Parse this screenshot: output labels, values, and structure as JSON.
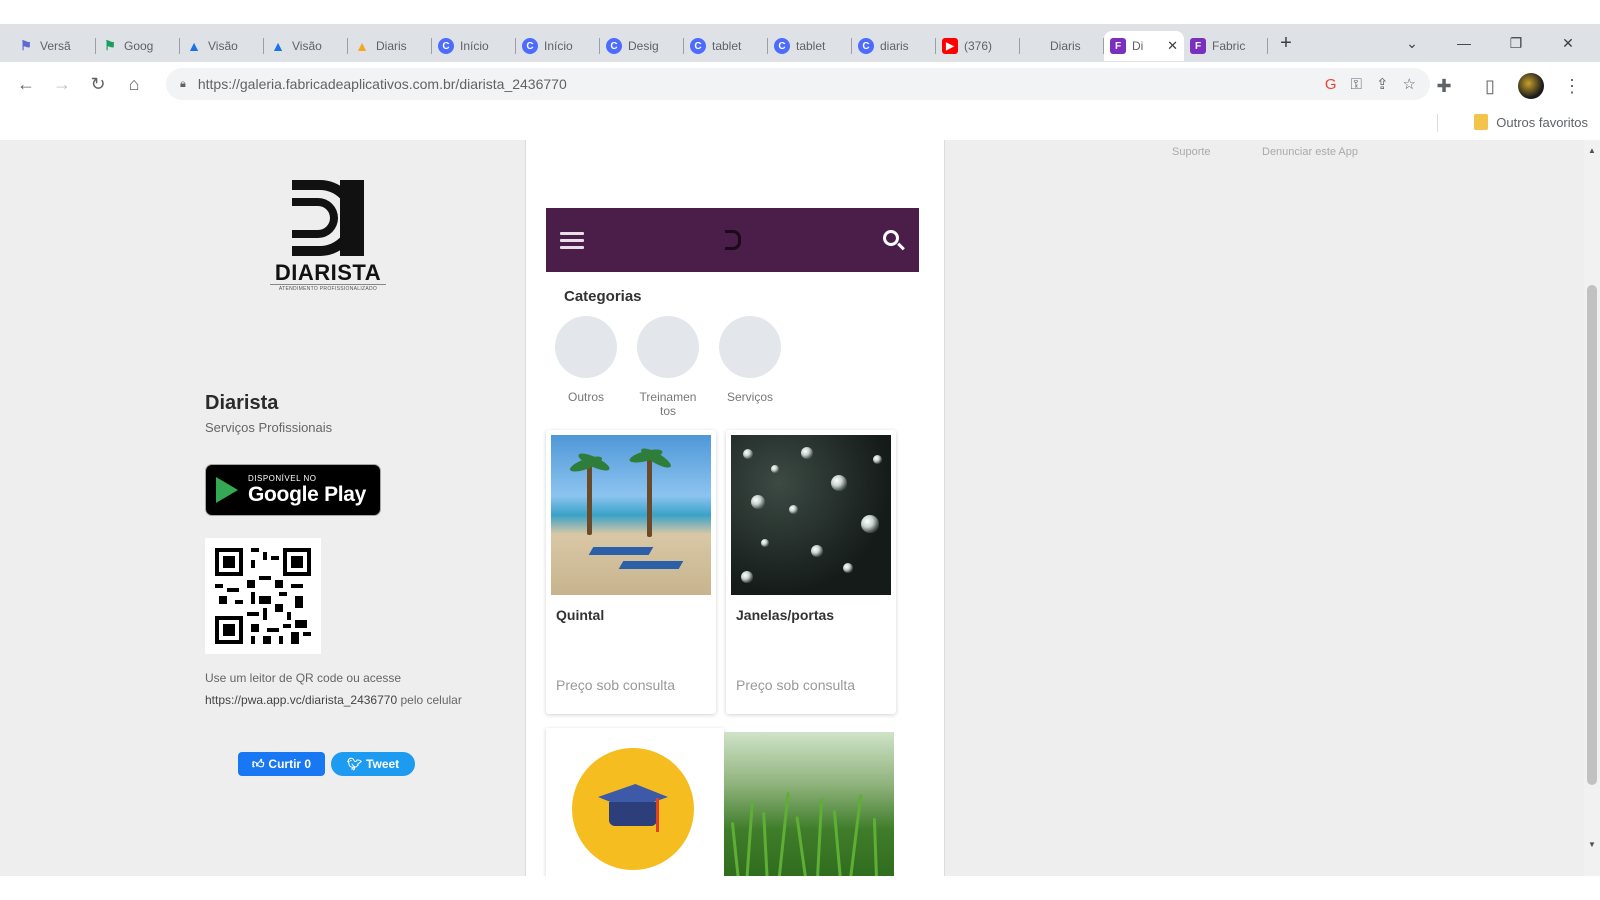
{
  "tabs": [
    {
      "label": "Versã",
      "icon": "flag-icon"
    },
    {
      "label": "Goog",
      "icon": "google-ads-icon"
    },
    {
      "label": "Visão",
      "icon": "google-ads-icon"
    },
    {
      "label": "Visão",
      "icon": "google-ads-icon"
    },
    {
      "label": "Diaris",
      "icon": "google-ads-icon"
    },
    {
      "label": "Início",
      "icon": "c-logo-icon"
    },
    {
      "label": "Início",
      "icon": "c-logo-icon"
    },
    {
      "label": "Desig",
      "icon": "c-logo-icon"
    },
    {
      "label": "tablet",
      "icon": "c-logo-icon"
    },
    {
      "label": "tablet",
      "icon": "c-logo-icon"
    },
    {
      "label": "diaris",
      "icon": "c-logo-icon"
    },
    {
      "label": "(376)",
      "icon": "youtube-icon"
    },
    {
      "label": "Diaris",
      "icon": "none"
    },
    {
      "label": "Di",
      "icon": "fabrica-icon",
      "active": true
    },
    {
      "label": "Fabric",
      "icon": "fabrica-icon"
    }
  ],
  "browser": {
    "url": "https://galeria.fabricadeaplicativos.com.br/diarista_2436770",
    "bookmarks_folder": "Outros favoritos"
  },
  "page": {
    "top_links": {
      "support": "Suporte",
      "report": "Denunciar este App"
    },
    "logo": {
      "word": "DIARISTA",
      "sub": "ATENDIMENTO PROFISSIONALIZADO"
    },
    "app_name": "Diarista",
    "app_category": "Serviços Profissionais",
    "google_play": {
      "small": "DISPONÍVEL NO",
      "big": "Google Play"
    },
    "qr_text_prefix": "Use um leitor de QR code ou acesse",
    "qr_text_url": "https://pwa.app.vc/diarista_2436770",
    "qr_text_suffix": "pelo celular",
    "facebook_label": "Curtir 0",
    "tweet_label": "Tweet"
  },
  "app": {
    "categories_title": "Categorias",
    "categories": [
      {
        "label": "Outros"
      },
      {
        "label": "Treinamentos"
      },
      {
        "label": "Serviços"
      }
    ],
    "products": [
      {
        "title": "Quintal",
        "price": "Preço sob consulta"
      },
      {
        "title": "Janelas/portas",
        "price": "Preço sob consulta"
      }
    ]
  },
  "colors": {
    "app_bar": "#4a1e48",
    "google_play": "#000000",
    "facebook": "#1877f2",
    "twitter": "#1d9bf0"
  }
}
